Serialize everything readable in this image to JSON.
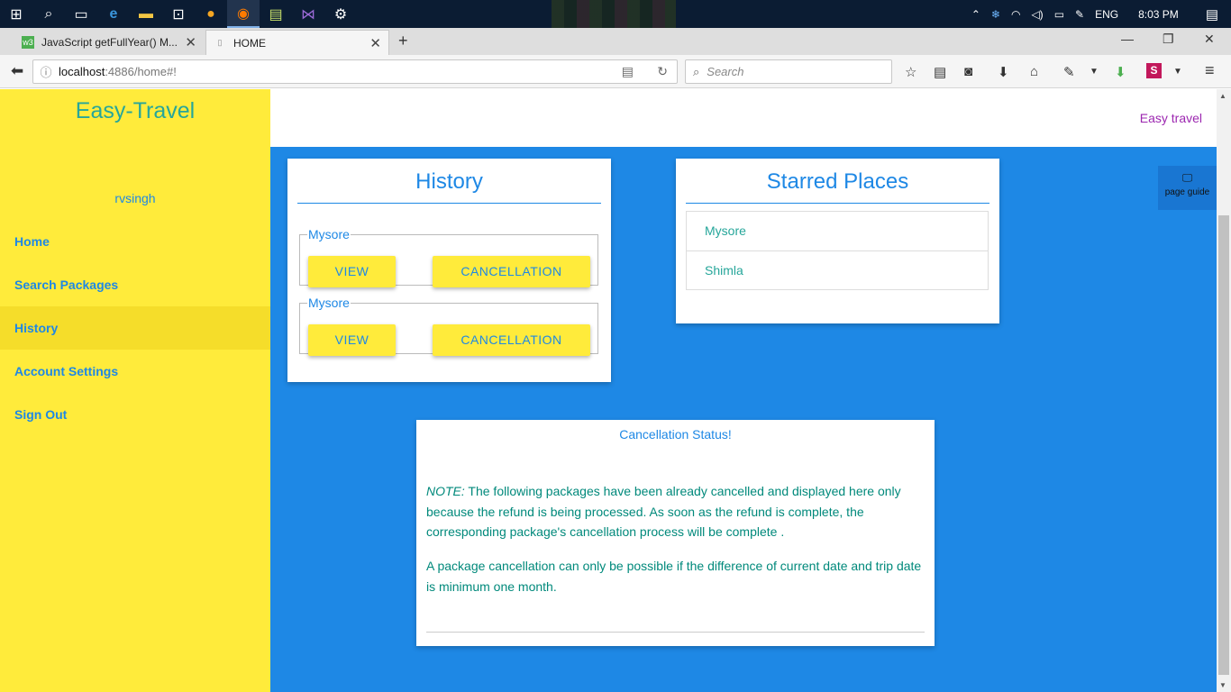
{
  "taskbar": {
    "tray_lang": "ENG",
    "tray_time": "8:03 PM"
  },
  "browser": {
    "tabs": [
      {
        "title": "JavaScript getFullYear() M...",
        "favicon": "w3-icon"
      },
      {
        "title": "HOME",
        "favicon": "page-icon"
      }
    ],
    "url_host": "localhost",
    "url_path": ":4886/home#!",
    "search_placeholder": "Search"
  },
  "sidebar": {
    "brand": "Easy-Travel",
    "username": "rvsingh",
    "items": [
      {
        "label": "Home"
      },
      {
        "label": "Search Packages"
      },
      {
        "label": "History"
      },
      {
        "label": "Account Settings"
      },
      {
        "label": "Sign Out"
      }
    ],
    "active_item": "History"
  },
  "topbar": {
    "title": "Easy travel"
  },
  "history": {
    "title": "History",
    "packages": [
      {
        "name": "Mysore",
        "view_label": "VIEW",
        "cancel_label": "CANCELLATION"
      },
      {
        "name": "Mysore",
        "view_label": "VIEW",
        "cancel_label": "CANCELLATION"
      }
    ]
  },
  "starred": {
    "title": "Starred Places",
    "places": [
      "Mysore",
      "Shimla"
    ]
  },
  "page_guide": {
    "label": "page guide"
  },
  "cancellation_status": {
    "title": "Cancellation Status!",
    "note_label": "NOTE:",
    "note_text": " The following packages have been already cancelled and displayed here only because the refund is being processed. As soon as the refund is complete, the corresponding package's cancellation process will be complete .",
    "rule_text": "A package cancellation can only be possible if the difference of current date and trip date is minimum one month."
  },
  "colors": {
    "page_bg": "#1e88e5",
    "sidebar_bg": "#ffeb3b",
    "accent_teal": "#26a69a",
    "accent_purple": "#9c27b0"
  }
}
